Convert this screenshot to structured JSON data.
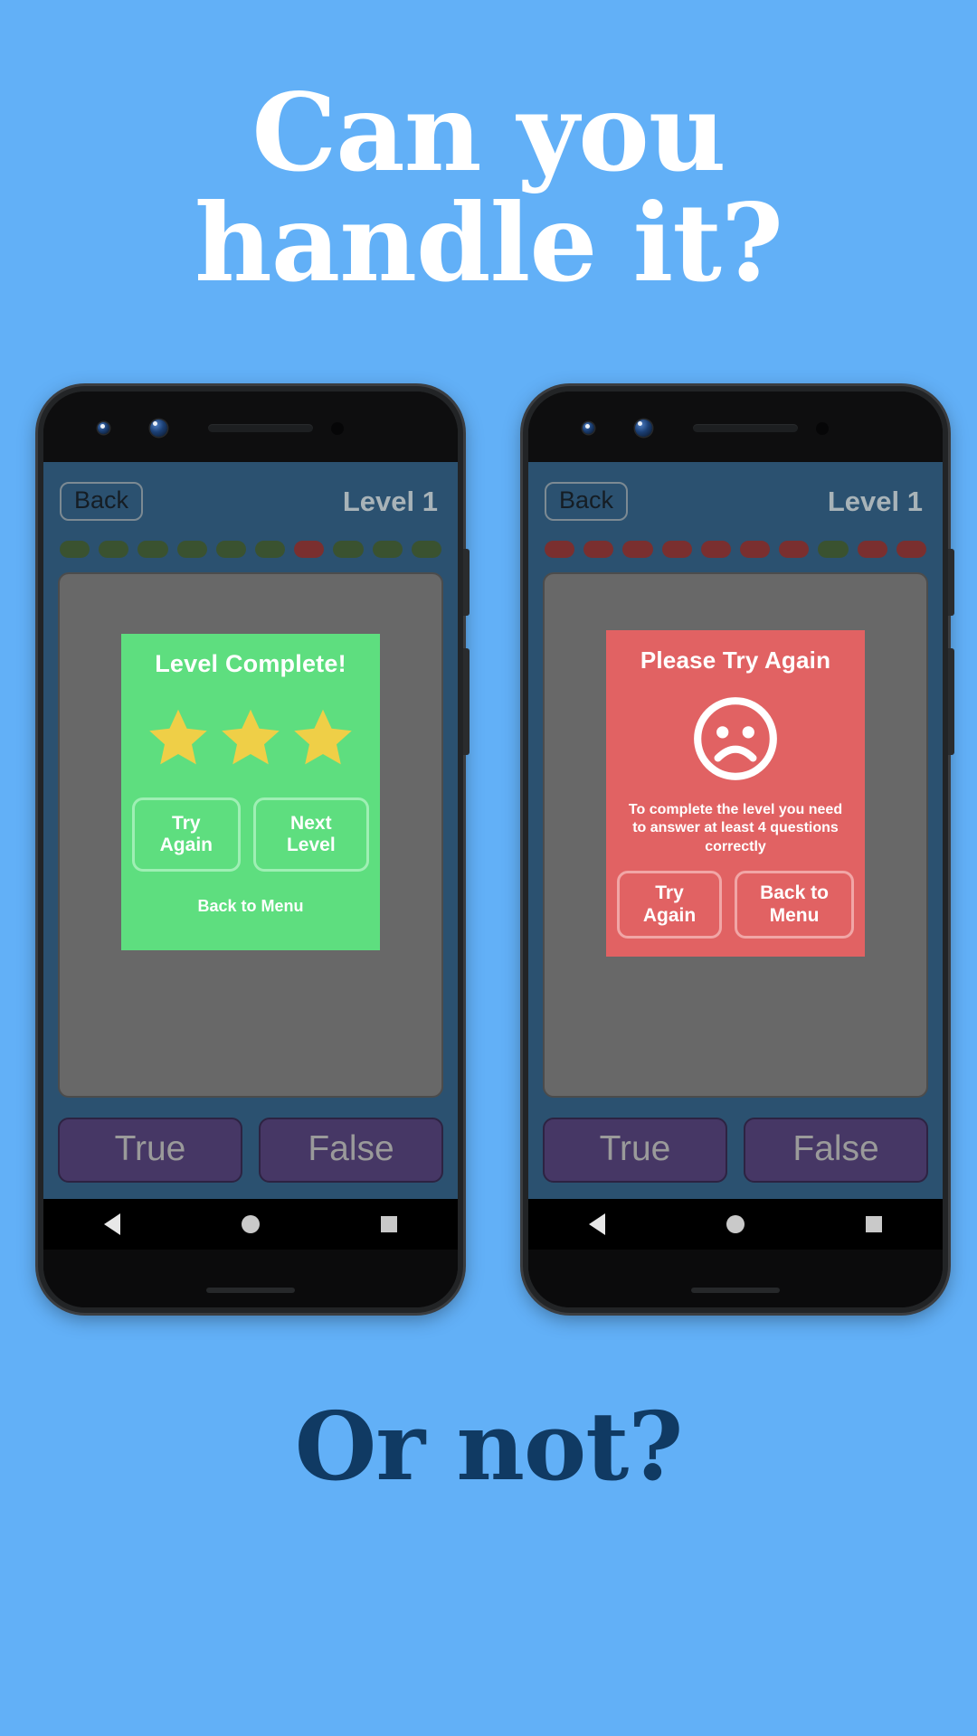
{
  "page": {
    "background_color": "#62b0f7",
    "headline_line1": "Can you",
    "headline_line2": "handle it?",
    "headline_color": "#ffffff",
    "footline": "Or not?",
    "footline_color": "#103a63"
  },
  "phones": [
    {
      "id": "left-phone",
      "topbar": {
        "back_label": "Back",
        "level_label": "Level 1"
      },
      "progress": {
        "states": [
          "correct",
          "correct",
          "correct",
          "correct",
          "correct",
          "correct",
          "wrong",
          "correct",
          "correct",
          "correct"
        ],
        "correct_color": "#3a5230",
        "wrong_color": "#7a2f2f"
      },
      "result": {
        "variant": "success",
        "background_color": "#5ede7f",
        "title": "Level Complete!",
        "stars_filled": 3,
        "star_color": "#efcf47",
        "buttons": [
          "Try Again",
          "Next Level"
        ],
        "link": "Back to Menu"
      },
      "answers": [
        "True",
        "False"
      ]
    },
    {
      "id": "right-phone",
      "topbar": {
        "back_label": "Back",
        "level_label": "Level 1"
      },
      "progress": {
        "states": [
          "wrong",
          "wrong",
          "wrong",
          "wrong",
          "wrong",
          "wrong",
          "wrong",
          "correct",
          "wrong",
          "wrong"
        ],
        "correct_color": "#3a5230",
        "wrong_color": "#7a2f2f"
      },
      "result": {
        "variant": "failure",
        "background_color": "#e16263",
        "title": "Please Try Again",
        "icon": "sad-face-icon",
        "description": "To complete the level you need to answer at least 4 questions correctly",
        "buttons": [
          "Try Again",
          "Back to Menu"
        ]
      },
      "answers": [
        "True",
        "False"
      ]
    }
  ],
  "navbar": {
    "back_icon": "triangle-back-icon",
    "home_icon": "circle-home-icon",
    "recents_icon": "square-recents-icon"
  }
}
